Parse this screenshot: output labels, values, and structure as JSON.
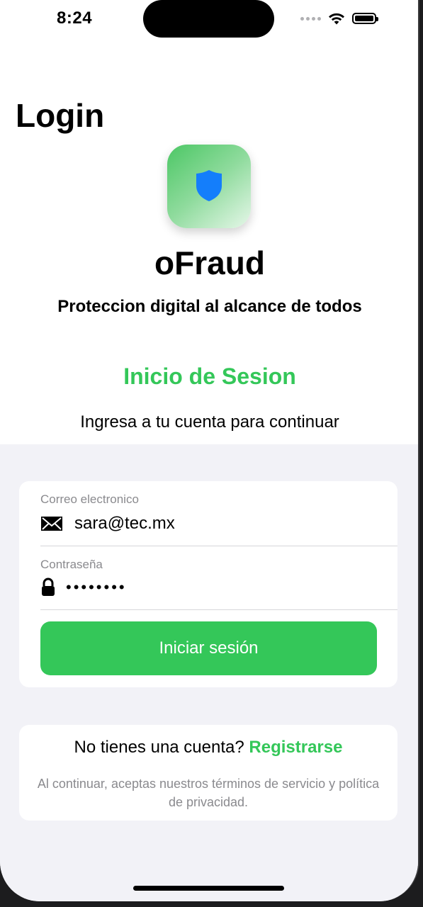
{
  "status_bar": {
    "time": "8:24"
  },
  "header": {
    "title": "Login"
  },
  "app": {
    "name": "oFraud",
    "tagline": "Proteccion digital al alcance de todos",
    "icon": "shield-icon"
  },
  "login_section": {
    "title": "Inicio de Sesion",
    "subtitle": "Ingresa a tu cuenta para continuar"
  },
  "form": {
    "email_label": "Correo electronico",
    "email_value": "sara@tec.mx",
    "email_icon": "envelope-icon",
    "password_label": "Contraseña",
    "password_value": "••••••••",
    "password_icon": "lock-icon",
    "submit_label": "Iniciar sesión"
  },
  "register": {
    "prompt": "No tienes una cuenta?",
    "link_label": "Registrarse",
    "terms": "Al continuar, aceptas nuestros términos de servicio y política de privacidad."
  },
  "colors": {
    "accent": "#34c759",
    "shield": "#147efb",
    "background_gray": "#f2f2f7"
  }
}
